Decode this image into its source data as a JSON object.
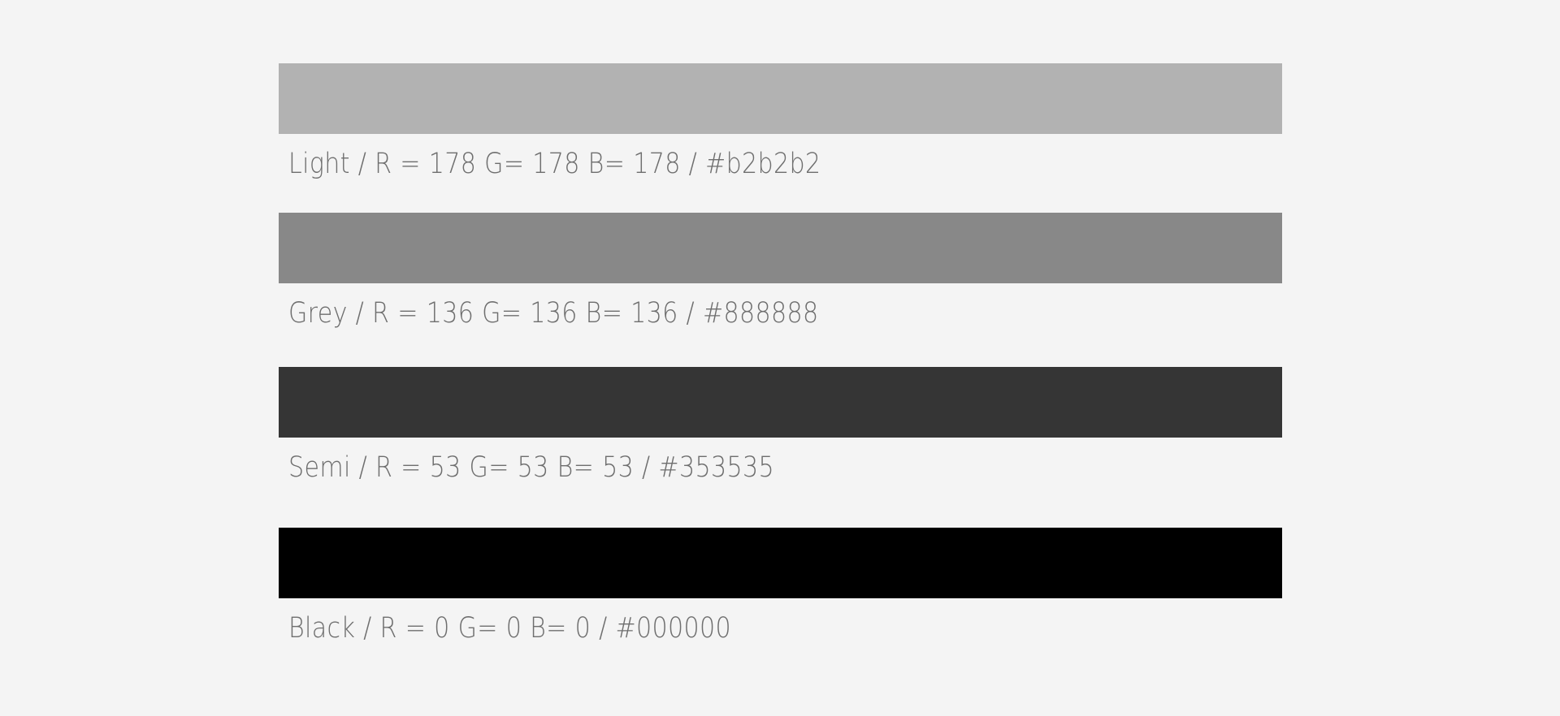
{
  "page": {
    "background_color": "#f4f4f4",
    "caption_text_color": "#6e6e6e"
  },
  "palette": {
    "swatches": [
      {
        "name": "Light",
        "caption": "Light  /  R = 178   G= 178  B= 178  /  #b2b2b2",
        "hex": "#b2b2b2",
        "r": 178,
        "g": 178,
        "b": 178
      },
      {
        "name": "Grey",
        "caption": "Grey   /  R = 136   G= 136   B= 136   /   #888888",
        "hex": "#888888",
        "r": 136,
        "g": 136,
        "b": 136
      },
      {
        "name": "Semi",
        "caption": "Semi  /  R = 53    G= 53     B= 53    /  #353535",
        "hex": "#353535",
        "r": 53,
        "g": 53,
        "b": 53
      },
      {
        "name": "Black",
        "caption": "Black  /  R = 0     G= 0    B= 0   /   #000000",
        "hex": "#000000",
        "r": 0,
        "g": 0,
        "b": 0
      }
    ]
  }
}
